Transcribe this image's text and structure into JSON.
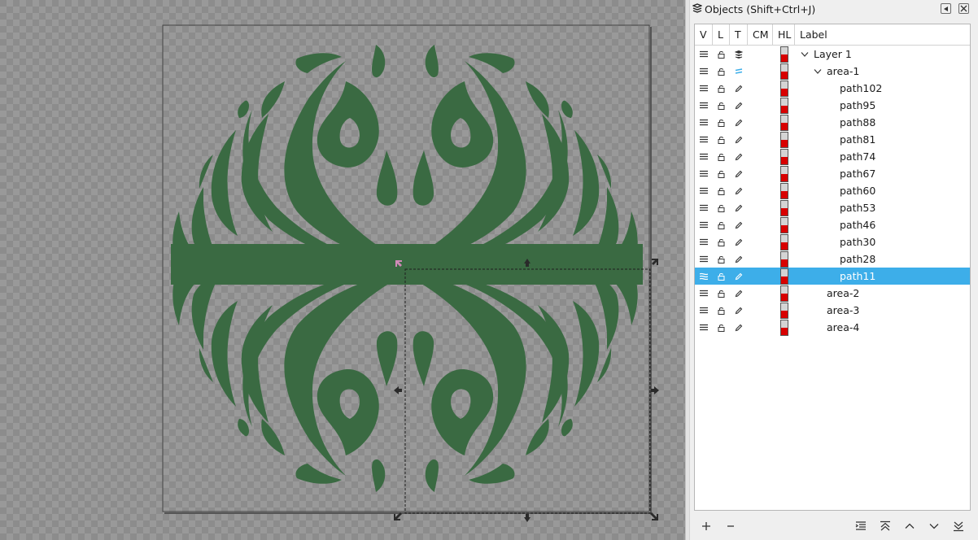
{
  "panel": {
    "title": "Objects (Shift+Ctrl+J)",
    "columns": {
      "visible": "V",
      "locked": "L",
      "type": "T",
      "clip_mask": "CM",
      "highlight": "HL",
      "label": "Label"
    },
    "rows": [
      {
        "label": "Layer 1",
        "indent": 0,
        "expander": "expanded",
        "type": "layer"
      },
      {
        "label": "area-1",
        "indent": 1,
        "expander": "expanded",
        "type": "group"
      },
      {
        "label": "path102",
        "indent": 2,
        "expander": "none",
        "type": "path"
      },
      {
        "label": "path95",
        "indent": 2,
        "expander": "none",
        "type": "path"
      },
      {
        "label": "path88",
        "indent": 2,
        "expander": "none",
        "type": "path"
      },
      {
        "label": "path81",
        "indent": 2,
        "expander": "none",
        "type": "path"
      },
      {
        "label": "path74",
        "indent": 2,
        "expander": "none",
        "type": "path"
      },
      {
        "label": "path67",
        "indent": 2,
        "expander": "none",
        "type": "path"
      },
      {
        "label": "path60",
        "indent": 2,
        "expander": "none",
        "type": "path"
      },
      {
        "label": "path53",
        "indent": 2,
        "expander": "none",
        "type": "path"
      },
      {
        "label": "path46",
        "indent": 2,
        "expander": "none",
        "type": "path"
      },
      {
        "label": "path30",
        "indent": 2,
        "expander": "none",
        "type": "path"
      },
      {
        "label": "path28",
        "indent": 2,
        "expander": "none",
        "type": "path"
      },
      {
        "label": "path11",
        "indent": 2,
        "expander": "none",
        "type": "path",
        "selected": true
      },
      {
        "label": "area-2",
        "indent": 1,
        "expander": "collapsed",
        "type": "path"
      },
      {
        "label": "area-3",
        "indent": 1,
        "expander": "collapsed",
        "type": "path"
      },
      {
        "label": "area-4",
        "indent": 1,
        "expander": "collapsed",
        "type": "path"
      }
    ],
    "footer_buttons": [
      "add-icon",
      "remove-icon",
      "indent-icon",
      "raise-to-top-icon",
      "raise-icon",
      "lower-icon",
      "lower-to-bottom-icon"
    ]
  },
  "canvas": {
    "fill_color": "#3a6a42",
    "selection_color": "#1f1f1f",
    "highlight_color": "#d80000",
    "selection_bg": "#3daee9"
  }
}
